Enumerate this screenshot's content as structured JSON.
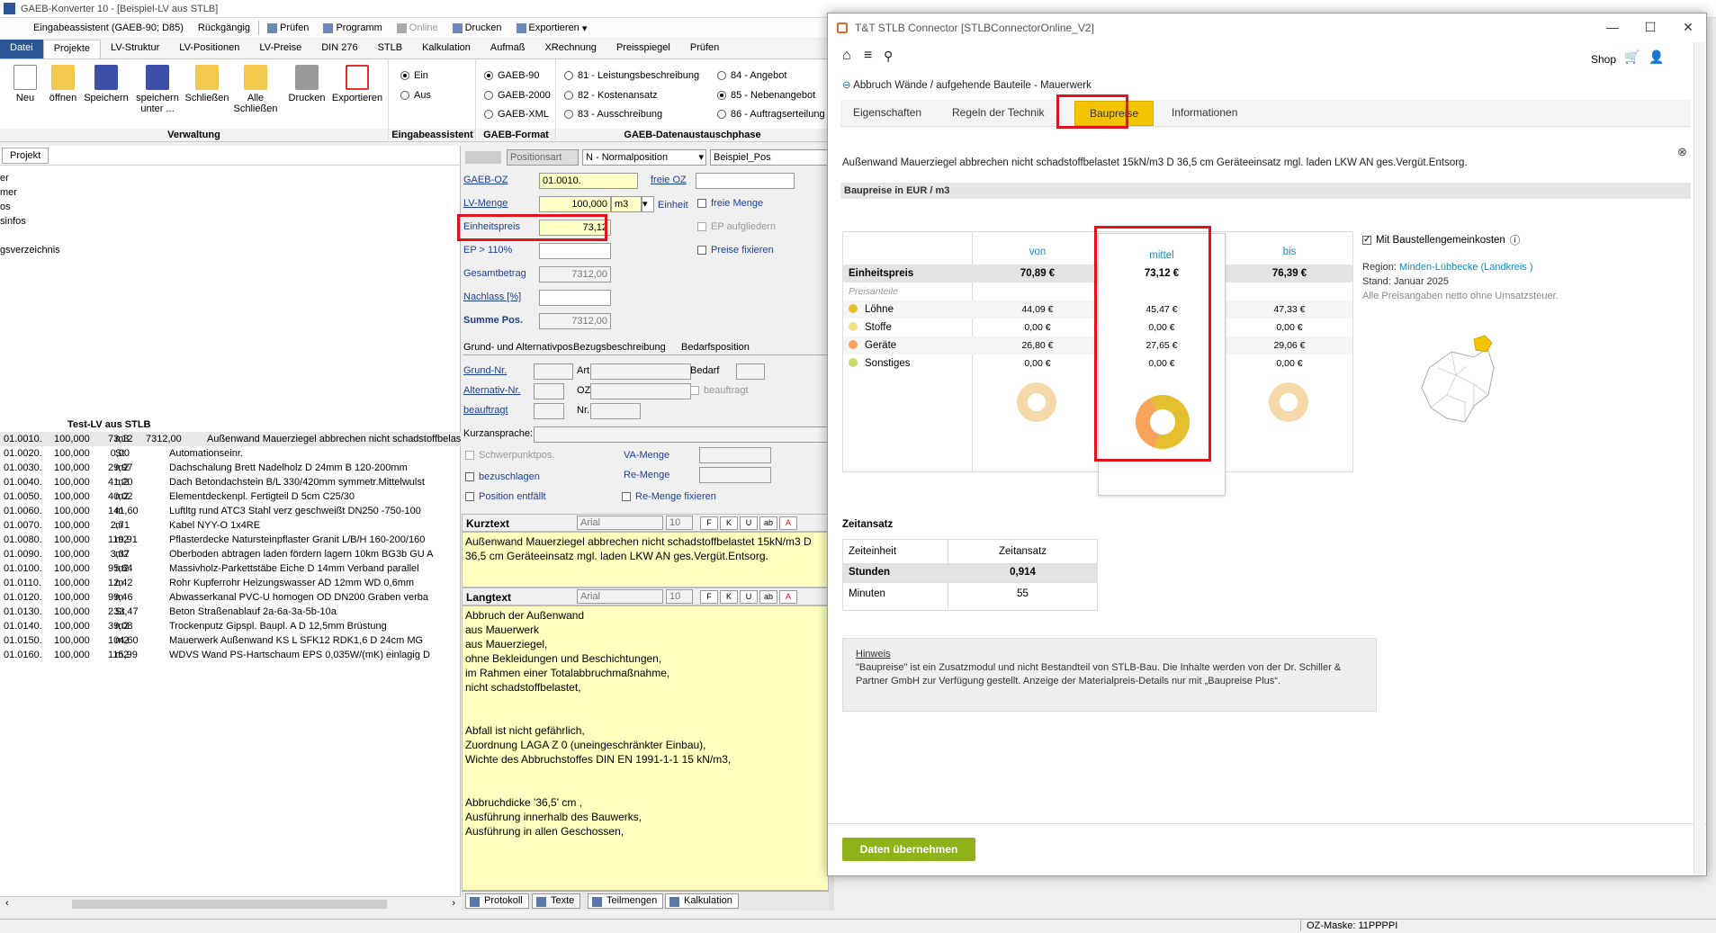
{
  "app": {
    "title": "GAEB-Konverter 10 - [Beispiel-LV aus STLB]"
  },
  "qat": {
    "assistant": "Eingabeassistent (GAEB-90; D85)",
    "undo": "Rückgängig",
    "check": "Prüfen",
    "program": "Programm",
    "online": "Online",
    "print": "Drucken",
    "export": "Exportieren"
  },
  "ribbon": {
    "tabs": [
      "Datei",
      "Projekte",
      "LV-Struktur",
      "LV-Positionen",
      "LV-Preise",
      "DIN 276",
      "STLB",
      "Kalkulation",
      "Aufmaß",
      "XRechnung",
      "Preisspiegel",
      "Prüfen"
    ],
    "verwaltung": {
      "label": "Verwaltung",
      "buttons": [
        "Neu",
        "öffnen",
        "Speichern",
        "speichern unter ...",
        "Schließen",
        "Alle Schließen",
        "Drucken",
        "Exportieren"
      ]
    },
    "eingabe": {
      "label": "Eingabeassistent",
      "on": "Ein",
      "off": "Aus"
    },
    "format": {
      "label": "GAEB-Format",
      "options": [
        "GAEB-90",
        "GAEB-2000",
        "GAEB-XML"
      ]
    },
    "austausch": {
      "label": "GAEB-Datenaustauschphase",
      "options": [
        "81 - Leistungsbeschreibung",
        "82 - Kostenansatz",
        "83 - Ausschreibung",
        "84 - Angebot",
        "85 - Nebenangebot",
        "86 - Auftragserteilung"
      ]
    }
  },
  "left": {
    "tab": "Projekt",
    "tree": [
      "er",
      "mer",
      "",
      "os",
      "sinfos",
      "",
      "gsverzeichnis"
    ],
    "lv_title": "Test-LV aus STLB",
    "rows": [
      {
        "oz": "01.0010.",
        "qty": "100,000",
        "unit": "m3",
        "ep": "73,12",
        "gp": "7312,00",
        "text": "Außenwand Mauerziegel abbrechen nicht schadstoffbelastet"
      },
      {
        "oz": "01.0020.",
        "qty": "100,000",
        "unit": "St",
        "ep": "0,00",
        "gp": "",
        "text": "Automationseinr."
      },
      {
        "oz": "01.0030.",
        "qty": "100,000",
        "unit": "m2",
        "ep": "29,97",
        "gp": "",
        "text": "Dachschalung Brett Nadelholz D 24mm B 120-200mm"
      },
      {
        "oz": "01.0040.",
        "qty": "100,000",
        "unit": "m2",
        "ep": "41,20",
        "gp": "",
        "text": "Dach Betondachstein B/L 330/420mm symmetr.Mittelwulst"
      },
      {
        "oz": "01.0050.",
        "qty": "100,000",
        "unit": "m2",
        "ep": "40,02",
        "gp": "",
        "text": "Elementdeckenpl. Fertigteil D 5cm C25/30"
      },
      {
        "oz": "01.0060.",
        "qty": "100,000",
        "unit": "m",
        "ep": "141,60",
        "gp": "",
        "text": "Luftltg rund ATC3 Stahl verz geschweißt DN250 -750-100"
      },
      {
        "oz": "01.0070.",
        "qty": "100,000",
        "unit": "m",
        "ep": "2,71",
        "gp": "",
        "text": "Kabel NYY-O 1x4RE"
      },
      {
        "oz": "01.0080.",
        "qty": "100,000",
        "unit": "m2",
        "ep": "119,91",
        "gp": "",
        "text": "Pflasterdecke Natursteinpflaster Granit L/B/H 160-200/160"
      },
      {
        "oz": "01.0090.",
        "qty": "100,000",
        "unit": "m2",
        "ep": "3,37",
        "gp": "",
        "text": "Oberboden abtragen laden fördern lagern 10km BG3b GU A"
      },
      {
        "oz": "01.0100.",
        "qty": "100,000",
        "unit": "m2",
        "ep": "95,84",
        "gp": "",
        "text": "Massivholz-Parkettstäbe Eiche D 14mm Verband parallel"
      },
      {
        "oz": "01.0110.",
        "qty": "100,000",
        "unit": "m",
        "ep": "12,42",
        "gp": "",
        "text": "Rohr Kupferrohr Heizungswasser AD 12mm WD 0,6mm"
      },
      {
        "oz": "01.0120.",
        "qty": "100,000",
        "unit": "m",
        "ep": "99,46",
        "gp": "",
        "text": "Abwasserkanal PVC-U homogen OD DN200 Graben verba"
      },
      {
        "oz": "01.0130.",
        "qty": "100,000",
        "unit": "St",
        "ep": "233,47",
        "gp": "",
        "text": "Beton Straßenablauf 2a-6a-3a-5b-10a"
      },
      {
        "oz": "01.0140.",
        "qty": "100,000",
        "unit": "m2",
        "ep": "39,08",
        "gp": "",
        "text": "Trockenputz Gipspl. Baupl. A D 12,5mm Brüstung"
      },
      {
        "oz": "01.0150.",
        "qty": "100,000",
        "unit": "m2",
        "ep": "104,60",
        "gp": "",
        "text": "Mauerwerk Außenwand KS L SFK12 RDK1,6 D 24cm MG"
      },
      {
        "oz": "01.0160.",
        "qty": "100,000",
        "unit": "m2",
        "ep": "115,99",
        "gp": "",
        "text": "WDVS Wand PS-Hartschaum EPS 0,035W/(mK) einlagig D"
      }
    ]
  },
  "mid": {
    "positionsart_label": "Positionsart",
    "positionsart": "N - Normalposition",
    "beispiel": "Beispiel_Pos",
    "gaeb_oz_label": "GAEB-OZ",
    "gaeb_oz": "01.0010.",
    "freie_oz_label": "freie OZ",
    "lv_menge_label": "LV-Menge",
    "lv_menge": "100,000",
    "einheit": "m3",
    "einheit_label": "Einheit",
    "freie_menge": "freie Menge",
    "ep_label": "Einheitspreis",
    "ep": "73,12",
    "ep_aufgl": "EP aufgliedern",
    "ep110_label": "EP > 110%",
    "preise_fix": "Preise fixieren",
    "gesamt_label": "Gesamtbetrag",
    "gesamt": "7312,00",
    "nachlass_label": "Nachlass [%]",
    "summe_label": "Summe Pos.",
    "summe": "7312,00",
    "grund_label": "Grund- und Alternativpos.",
    "bezug_label": "Bezugsbeschreibung",
    "bedarf_label": "Bedarfsposition",
    "grundnr": "Grund-Nr.",
    "altnr": "Alternativ-Nr.",
    "beauftragt": "beauftragt",
    "art": "Art",
    "oz": "OZ",
    "nr": "Nr.",
    "bedarf": "Bedarf",
    "beauftragt2": "beauftragt",
    "kurzansprache": "Kurzansprache:",
    "schwerpunkt": "Schwerpunktpos.",
    "bezuschlagen": "bezuschlagen",
    "pos_entf": "Position entfällt",
    "va_menge": "VA-Menge",
    "re_menge": "Re-Menge",
    "re_fix": "Re-Menge fixieren",
    "kurztext_label": "Kurztext",
    "langtext_label": "Langtext",
    "font": "Arial",
    "size": "10",
    "kurztext": "Außenwand Mauerziegel abbrechen nicht schadstoffbelastet 15kN/m3 D 36,5 cm Geräteeinsatz mgl. laden LKW AN ges.Vergüt.Entsorg.",
    "langtext": [
      "Abbruch der Außenwand",
      "aus Mauerwerk",
      "aus Mauerziegel,",
      "ohne Bekleidungen und Beschichtungen,",
      "im Rahmen einer Totalabbruchmaßnahme,",
      "nicht schadstoffbelastet,",
      "",
      "",
      "Abfall ist nicht gefährlich,",
      "Zuordnung LAGA Z 0 (uneingeschränkter Einbau),",
      "Wichte des Abbruchstoffes DIN EN 1991-1-1 15 kN/m3,",
      "",
      "",
      "Abbruchdicke '36,5' cm ,",
      "Ausführung innerhalb des Bauwerks,",
      "Ausführung in allen Geschossen,"
    ],
    "bottom_tabs": [
      "Protokoll",
      "Texte",
      "Teilmengen",
      "Kalkulation"
    ]
  },
  "status": {
    "text": "OZ-Maske: 11PPPPI"
  },
  "stlb": {
    "title": "T&T STLB Connector [STLBConnectorOnline_V2]",
    "shop": "Shop",
    "crumb": "Abbruch Wände / aufgehende Bauteile - Mauerwerk",
    "tabs": [
      "Eigenschaften",
      "Regeln der Technik",
      "Baupreise",
      "Informationen"
    ],
    "desc": "Außenwand Mauerziegel abbrechen nicht schadstoffbelastet 15kN/m3 D 36,5 cm Geräteeinsatz mgl. laden LKW AN ges.Vergüt.Entsorg.",
    "section": "Baupreise in EUR / m3",
    "cols": [
      "von",
      "mittel",
      "bis"
    ],
    "ep_label": "Einheitspreis",
    "ep": [
      "70,89 €",
      "73,12 €",
      "76,39 €"
    ],
    "anteile_label": "Preisanteile",
    "anteile": [
      {
        "name": "Löhne",
        "color": "#e6bf2e",
        "v": [
          "44,09 €",
          "45,47 €",
          "47,33 €"
        ]
      },
      {
        "name": "Stoffe",
        "color": "#f1e08c",
        "v": [
          "0,00 €",
          "0,00 €",
          "0,00 €"
        ]
      },
      {
        "name": "Geräte",
        "color": "#f7a35c",
        "v": [
          "26,80 €",
          "27,65 €",
          "29,06 €"
        ]
      },
      {
        "name": "Sonstiges",
        "color": "#c9d86a",
        "v": [
          "0,00 €",
          "0,00 €",
          "0,00 €"
        ]
      }
    ],
    "mit_bgk": "Mit Baustellengemeinkosten",
    "region_label": "Region:",
    "region": "Minden-Lübbecke (Landkreis )",
    "stand": "Stand: Januar 2025",
    "netto": "Alle Preisangaben netto ohne Umsatzsteuer.",
    "zeit_title": "Zeitansatz",
    "zeit_h1": "Zeiteinheit",
    "zeit_h2": "Zeitansatz",
    "stunden": "Stunden",
    "stunden_v": "0,914",
    "minuten": "Minuten",
    "minuten_v": "55",
    "hinweis_t": "Hinweis",
    "hinweis": "\"Baupreise\" ist ein Zusatzmodul und nicht Bestandteil von STLB-Bau. Die Inhalte werden von der Dr. Schiller & Partner GmbH zur Verfügung gestellt. Anzeige der Materialpreis-Details nur mit „Baupreise Plus“.",
    "button": "Daten übernehmen"
  }
}
